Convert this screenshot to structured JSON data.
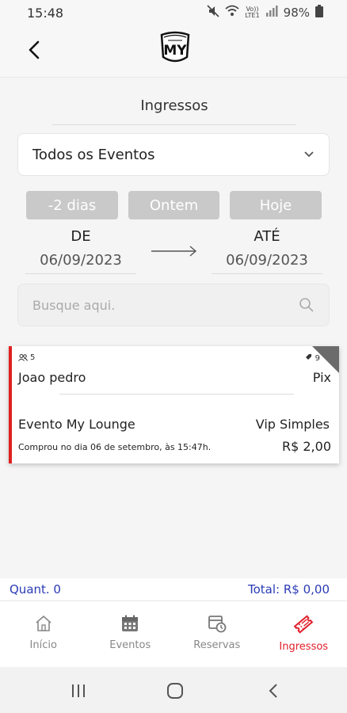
{
  "status": {
    "time": "15:48",
    "network_label_top": "Vo))",
    "network_label_bottom": "LTE1",
    "battery": "98%"
  },
  "page": {
    "title": "Ingressos"
  },
  "filter": {
    "event_selected": "Todos os Eventos",
    "quick_ranges": [
      "-2 dias",
      "Ontem",
      "Hoje"
    ],
    "from_label": "DE",
    "from_date": "06/09/2023",
    "to_label": "ATÉ",
    "to_date": "06/09/2023",
    "search_placeholder": "Busque aqui."
  },
  "tickets": [
    {
      "quantity": "5",
      "id": "9",
      "buyer": "Joao pedro",
      "payment_method": "Pix",
      "event": "Evento My Lounge",
      "ticket_type": "Vip Simples",
      "purchase_info": "Comprou no dia 06 de setembro, às 15:47h.",
      "price": "R$ 2,00"
    }
  ],
  "totals": {
    "quantity": "Quant. 0",
    "total": "Total: R$ 0,00"
  },
  "nav": {
    "items": [
      {
        "label": "Início",
        "icon": "home-icon"
      },
      {
        "label": "Eventos",
        "icon": "calendar-icon"
      },
      {
        "label": "Reservas",
        "icon": "reservation-icon"
      },
      {
        "label": "Ingressos",
        "icon": "ticket-icon"
      }
    ],
    "active_color": "#e0202a"
  },
  "colors": {
    "accent_red": "#e0202a",
    "totals_blue": "#2a3bb5"
  }
}
